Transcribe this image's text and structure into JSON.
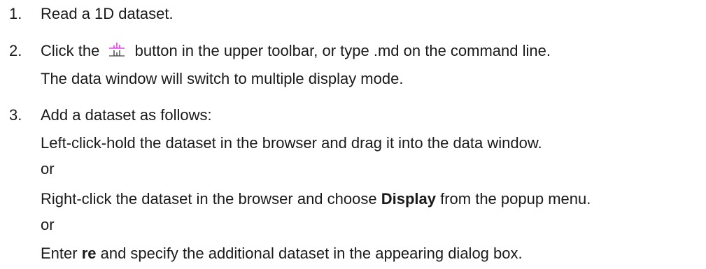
{
  "steps": [
    {
      "number": "1.",
      "text": "Read a 1D dataset."
    },
    {
      "number": "2.",
      "text_before_icon": "Click the",
      "icon": "multiple-display-icon",
      "text_after_icon": "button in the upper toolbar, or type .md on the command line.",
      "note": "The data window will switch to multiple display mode."
    },
    {
      "number": "3.",
      "text": "Add a dataset as follows:",
      "option1": "Left-click-hold the dataset in the browser and drag it into the data window.",
      "or1": "or",
      "option2_before": "Right-click the dataset in the browser and choose ",
      "option2_bold": "Display",
      "option2_after": " from the popup menu.",
      "or2": "or",
      "option3_before": "Enter ",
      "option3_bold": "re",
      "option3_after": " and specify the additional dataset in the appearing dialog box."
    }
  ],
  "colors": {
    "text": "#1a1a1a",
    "icon_top": "#e020e0",
    "icon_bottom": "#404040"
  }
}
